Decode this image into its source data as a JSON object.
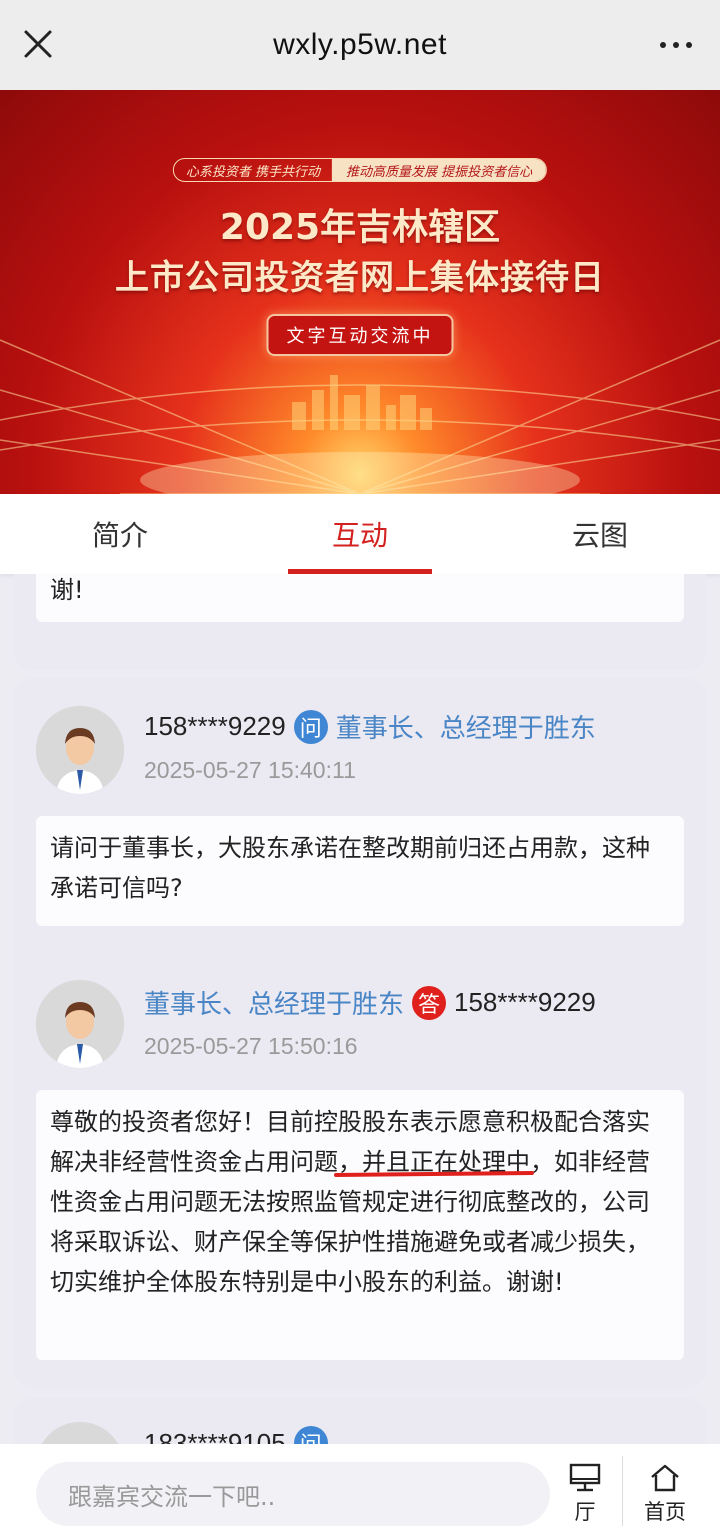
{
  "topbar": {
    "url": "wxly.p5w.net"
  },
  "banner": {
    "slogan_left": "心系投资者 携手共行动",
    "slogan_right": "推动高质量发展 提振投资者信心",
    "title_line1": "2025年吉林辖区",
    "title_line2": "上市公司投资者网上集体接待日",
    "status_pill": "文字互动交流中",
    "colors": {
      "primary_red": "#b8100f",
      "gold": "#fde8c8"
    }
  },
  "tabs": [
    {
      "label": "简介",
      "active": false
    },
    {
      "label": "互动",
      "active": true
    },
    {
      "label": "云图",
      "active": false
    }
  ],
  "feed": {
    "partial_top": {
      "text": "谢!"
    },
    "thread": {
      "question": {
        "user": "158****9229",
        "badge": "问",
        "to": "董事长、总经理于胜东",
        "time": "2025-05-27 15:40:11",
        "text": "请问于董事长，大股东承诺在整改期前归还占用款，这种承诺可信吗?"
      },
      "answer": {
        "user": "董事长、总经理于胜东",
        "badge": "答",
        "to": "158****9229",
        "time": "2025-05-27 15:50:16",
        "text_before": "尊敬的投资者您好！目前控股股东表示愿意积极配合落实解决非经营性资金占用问题",
        "text_marked": "，并且正在处理中",
        "text_after": "，如非经营性资金占用问题无法按照监管规定进行彻底整改的，公司将采取诉讼、财产保全等保护性措施避免或者减少损失，切实维护全体股东特别是中小股东的利益。谢谢!"
      }
    },
    "partial_bottom": {
      "user": "183****9105",
      "badge": "问"
    }
  },
  "bottombar": {
    "input_placeholder": "跟嘉宾交流一下吧..",
    "hall_label": "厅",
    "home_label": "首页"
  }
}
